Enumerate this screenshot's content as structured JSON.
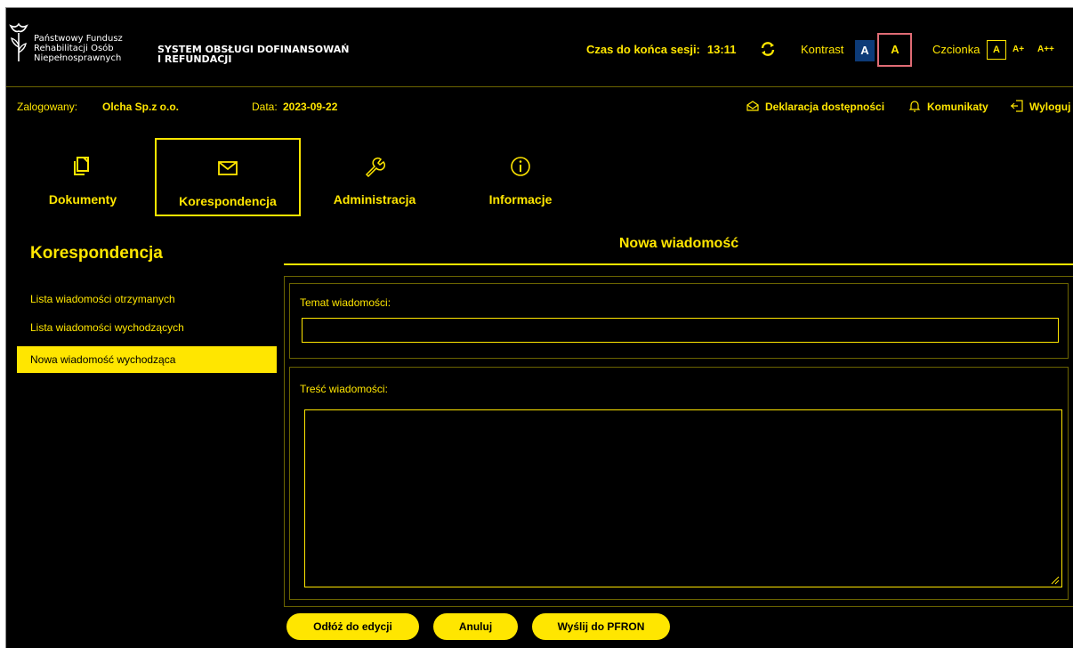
{
  "header": {
    "logo_lines": [
      "Państwowy Fundusz",
      "Rehabilitacji Osób",
      "Niepełnosprawnych"
    ],
    "system_name_lines": [
      "SYSTEM OBSŁUGI DOFINANSOWAŃ",
      "I REFUNDACJI"
    ],
    "session_label": "Czas do końca sesji:",
    "session_time": "13:11",
    "contrast_label": "Kontrast",
    "contrast_option_1": "A",
    "contrast_option_2": "A",
    "font_label": "Czcionka",
    "font_normal": "A",
    "font_large": "A+",
    "font_xlarge": "A++"
  },
  "info_bar": {
    "logged_label": "Zalogowany:",
    "logged_user": "Olcha Sp.z o.o.",
    "date_label": "Data:",
    "date_value": "2023-09-22",
    "accessibility_link": "Deklaracja dostępności",
    "messages_link": "Komunikaty",
    "logout_link": "Wyloguj"
  },
  "main_nav": {
    "items": [
      {
        "label": "Dokumenty",
        "icon": "documents-icon"
      },
      {
        "label": "Korespondencja",
        "icon": "envelope-icon",
        "active": true
      },
      {
        "label": "Administracja",
        "icon": "wrench-icon"
      },
      {
        "label": "Informacje",
        "icon": "info-icon"
      }
    ]
  },
  "sidebar": {
    "title": "Korespondencja",
    "items": [
      {
        "label": "Lista wiadomości otrzymanych"
      },
      {
        "label": "Lista wiadomości wychodzących"
      },
      {
        "label": "Nowa wiadomość wychodząca",
        "active": true
      }
    ]
  },
  "form": {
    "title": "Nowa wiadomość",
    "subject_label": "Temat wiadomości:",
    "subject_value": "",
    "body_label": "Treść wiadomości:",
    "body_value": "",
    "buttons": {
      "save_draft": "Odłóż do edycji",
      "cancel": "Anuluj",
      "send": "Wyślij do PFRON"
    }
  },
  "colors": {
    "accent": "#ffe600",
    "background": "#000000",
    "contrast_blue": "#0d3b78",
    "focus_outline": "#e06c75"
  }
}
